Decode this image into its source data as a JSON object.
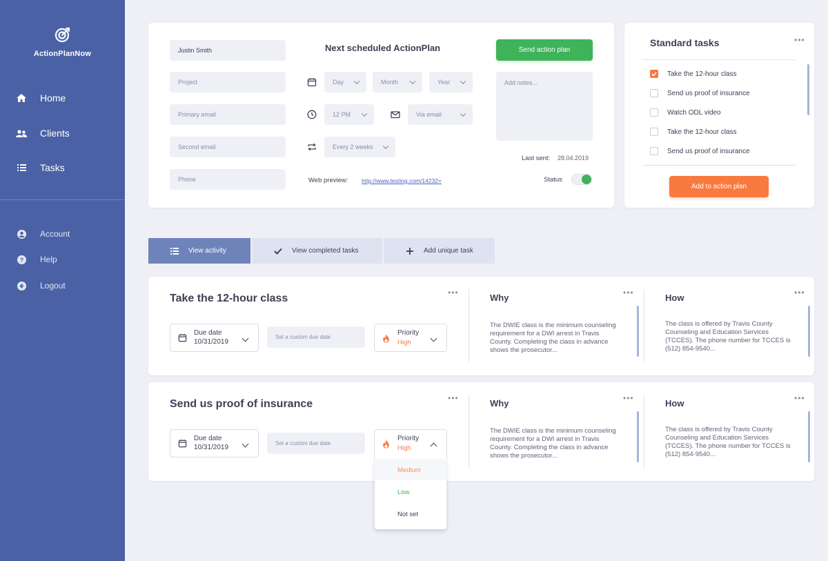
{
  "app": {
    "name": "ActionPlanNow"
  },
  "sidebar": {
    "main_items": [
      {
        "label": "Home",
        "icon": "home-icon"
      },
      {
        "label": "Clients",
        "icon": "users-icon"
      },
      {
        "label": "Tasks",
        "icon": "list-icon"
      }
    ],
    "sub_items": [
      {
        "label": "Account",
        "icon": "user-circle-icon"
      },
      {
        "label": "Help",
        "icon": "help-icon"
      },
      {
        "label": "Logout",
        "icon": "logout-icon"
      }
    ]
  },
  "plan_form": {
    "client_name": "Justin Smith",
    "project_placeholder": "Project",
    "primary_email_placeholder": "Primary email",
    "second_email_placeholder": "Second email",
    "phone_placeholder": "Phone",
    "heading": "Next scheduled ActionPlan",
    "day": "Day",
    "month": "Month",
    "year": "Year",
    "time": "12 PM",
    "delivery": "Via email",
    "frequency": "Every 2 weeks",
    "web_preview_label": "Web preview:",
    "web_preview_url": "http://www.testing.com/14232=",
    "send_button": "Send action plan",
    "notes_placeholder": "Add notes...",
    "last_sent_label": "Last sent:",
    "last_sent_value": "28.04.2019",
    "status_label": "Status",
    "status_on": true
  },
  "standard_tasks": {
    "title": "Standard tasks",
    "items": [
      {
        "label": "Take the 12-hour class",
        "checked": true
      },
      {
        "label": "Send us proof of insurance",
        "checked": false
      },
      {
        "label": "Watch ODL video",
        "checked": false
      },
      {
        "label": "Take the 12-hour class",
        "checked": false
      },
      {
        "label": "Send us proof of insurance",
        "checked": false
      }
    ],
    "add_button": "Add to action plan"
  },
  "tabs": [
    {
      "label": "View activity",
      "active": true
    },
    {
      "label": "View completed tasks",
      "active": false
    },
    {
      "label": "Add unique task",
      "active": false
    }
  ],
  "tasks": [
    {
      "title": "Take the 12-hour class",
      "due_label": "Due date",
      "due_value": "10/31/2019",
      "custom_due_placeholder": "Set a custom due date",
      "priority_label": "Priority",
      "priority_value": "High",
      "why_head": "Why",
      "why_text": "The DWIE class is the minimum counseling requirement for a DWI arrest in Travis County. Completing the class in advance shows the prosecutor...",
      "how_head": "How",
      "how_text": "The class is offered by Travis County Counseling and Education Services (TCCES). The phone number for TCCES is (512) 854-9540..."
    },
    {
      "title": "Send us proof of insurance",
      "due_label": "Due date",
      "due_value": "10/31/2019",
      "custom_due_placeholder": "Set a custom due date",
      "priority_label": "Priority",
      "priority_value": "High",
      "why_head": "Why",
      "why_text": "The DWIE class is the minimum counseling requirement for a DWI arrest in Travis County. Completing the class in advance shows the prosecutor...",
      "how_head": "How",
      "how_text": "The class is offered by Travis County Counseling and Education Services (TCCES). The phone number for TCCES is (512) 854-9540..."
    }
  ],
  "priority_dropdown": {
    "options": [
      {
        "label": "Medium",
        "color": "#f0955a"
      },
      {
        "label": "Low",
        "color": "#3fb35a"
      },
      {
        "label": "Not set",
        "color": "#3d4055"
      }
    ]
  },
  "colors": {
    "sidebar": "#4a62a5",
    "accent_green": "#3fb35a",
    "accent_orange": "#f87a3e",
    "tab_active": "#6f83bb"
  }
}
